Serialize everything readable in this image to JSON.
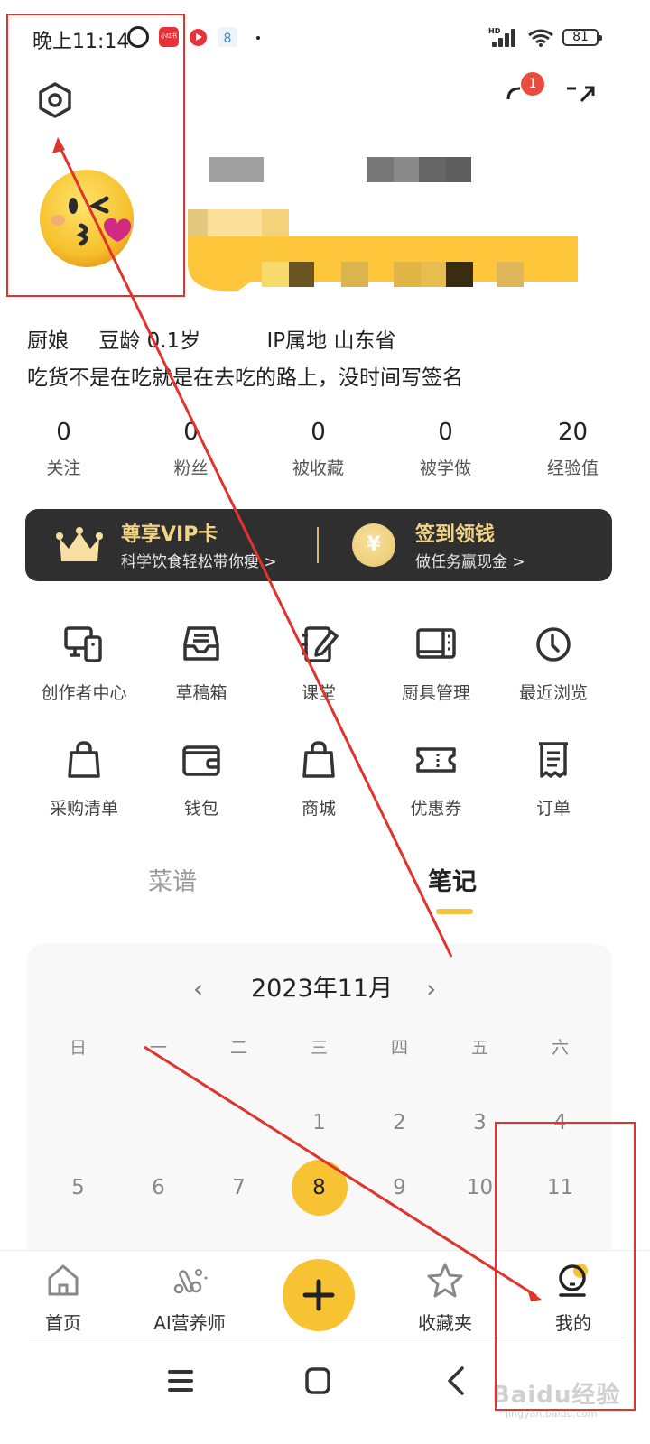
{
  "status_bar": {
    "time": "晚上11:14",
    "app1_label": "小红书",
    "app3_label": "8",
    "signal_label": "HD",
    "battery": "81"
  },
  "top_actions": {
    "message_badge": "1"
  },
  "profile": {
    "role": "厨娘",
    "age": "豆龄 0.1岁",
    "ip": "IP属地 山东省",
    "bio": "吃货不是在吃就是在去吃的路上，没时间写签名"
  },
  "stats": [
    {
      "value": "0",
      "label": "关注"
    },
    {
      "value": "0",
      "label": "粉丝"
    },
    {
      "value": "0",
      "label": "被收藏"
    },
    {
      "value": "0",
      "label": "被学做"
    },
    {
      "value": "20",
      "label": "经验值"
    }
  ],
  "vip_banner": {
    "vip_title": "尊享VIP卡",
    "vip_sub": "科学饮食轻松带你瘦 >",
    "coin_symbol": "¥",
    "checkin_title": "签到领钱",
    "checkin_sub": "做任务赢现金 >"
  },
  "grid": [
    {
      "label": "创作者中心",
      "icon": "devices-icon"
    },
    {
      "label": "草稿箱",
      "icon": "inbox-icon"
    },
    {
      "label": "课堂",
      "icon": "notebook-pen-icon"
    },
    {
      "label": "厨具管理",
      "icon": "microwave-icon"
    },
    {
      "label": "最近浏览",
      "icon": "clock-icon"
    },
    {
      "label": "采购清单",
      "icon": "shopping-bag-icon"
    },
    {
      "label": "钱包",
      "icon": "wallet-icon"
    },
    {
      "label": "商城",
      "icon": "shopping-bag-icon"
    },
    {
      "label": "优惠券",
      "icon": "ticket-icon"
    },
    {
      "label": "订单",
      "icon": "receipt-icon"
    }
  ],
  "tabs": [
    {
      "label": "菜谱",
      "active": false
    },
    {
      "label": "笔记",
      "active": true
    }
  ],
  "calendar": {
    "prev": "‹",
    "next": "›",
    "title": "2023年11月",
    "weekdays": [
      "日",
      "一",
      "二",
      "三",
      "四",
      "五",
      "六"
    ],
    "rows": [
      [
        "",
        "",
        "",
        "1",
        "2",
        "3",
        "4"
      ],
      [
        "5",
        "6",
        "7",
        "8",
        "9",
        "10",
        "11"
      ]
    ],
    "selected_day": "8"
  },
  "bottom_nav": [
    {
      "label": "首页",
      "icon": "home-icon"
    },
    {
      "label": "AI营养师",
      "icon": "ai-nutritionist-icon"
    },
    {
      "label": "",
      "icon": "plus-icon"
    },
    {
      "label": "收藏夹",
      "icon": "star-icon"
    },
    {
      "label": "我的",
      "icon": "profile-icon"
    }
  ],
  "colors": {
    "accent": "#f8c333",
    "banner_bg": "#2f2f30",
    "banner_gold": "#f1d383",
    "badge_red": "#e74c3c",
    "annotation_red": "#e0342c"
  },
  "watermark": {
    "main": "Baidu经验",
    "sub": "jingyan.baidu.com"
  }
}
